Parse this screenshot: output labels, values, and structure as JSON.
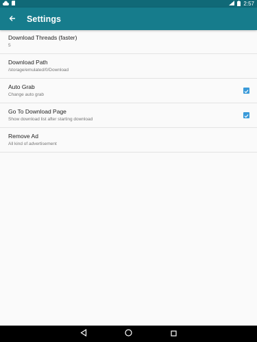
{
  "status_bar": {
    "time": "2:57",
    "icons": [
      "cloud-icon",
      "sd-card-icon",
      "signal-icon",
      "battery-icon"
    ]
  },
  "app_bar": {
    "title": "Settings",
    "back_icon": "arrow-back-icon"
  },
  "settings": [
    {
      "title": "Download Threads (faster)",
      "summary": "5"
    },
    {
      "title": "Download Path",
      "summary": "/storage/emulated/0/Download"
    },
    {
      "title": "Auto Grab",
      "summary": "Change auto grab",
      "checked": true
    },
    {
      "title": "Go To Download Page",
      "summary": "Show download list after starting download",
      "checked": true
    },
    {
      "title": "Remove Ad",
      "summary": "All kind of advertisement"
    }
  ],
  "nav_bar": {
    "icons": [
      "back-triangle-icon",
      "home-circle-icon",
      "recents-square-icon"
    ]
  },
  "colors": {
    "status_bar": "#106977",
    "app_bar": "#167c8c",
    "checkbox": "#3a9ad9",
    "background": "#fafafa"
  }
}
